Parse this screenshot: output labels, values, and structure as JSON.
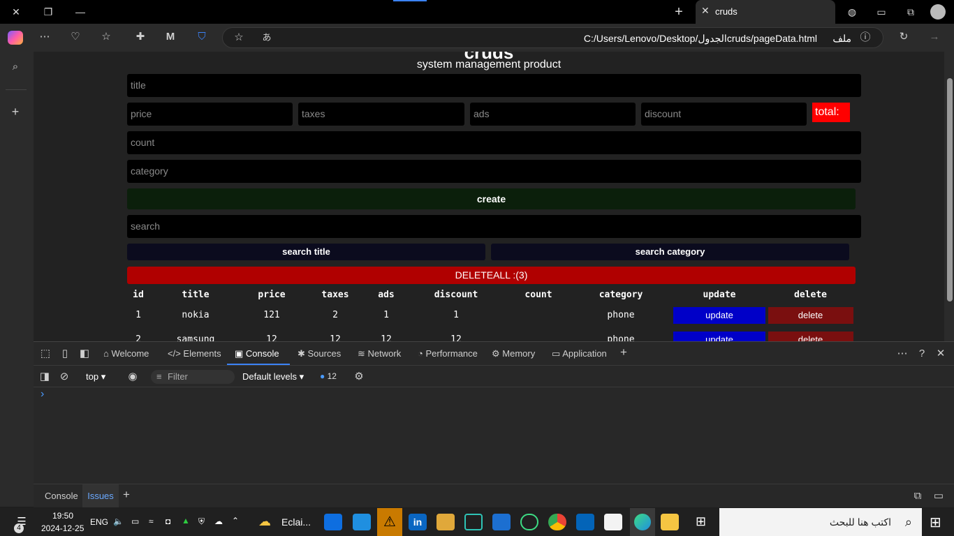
{
  "browser": {
    "tab_title": "cruds",
    "url": "C:/Users/Lenovo/Desktop/الجدولcruds/pageData.html",
    "file_label": "ملف"
  },
  "page": {
    "heading": "cruds",
    "subheading": "system management product",
    "inputs": {
      "title": "title",
      "price": "price",
      "taxes": "taxes",
      "ads": "ads",
      "discount": "discount",
      "count": "count",
      "category": "category",
      "search": "search"
    },
    "total_label": "total:",
    "create_label": "create",
    "search_title_label": "search title",
    "search_category_label": "search category",
    "delete_all_label": "DELETEALL :(3)",
    "table": {
      "headers": [
        "id",
        "title",
        "price",
        "taxes",
        "ads",
        "discount",
        "count",
        "category",
        "update",
        "delete"
      ],
      "rows": [
        {
          "id": "1",
          "title": "nokia",
          "price": "121",
          "taxes": "2",
          "ads": "1",
          "discount": "1",
          "count": "",
          "category": "phone",
          "update": "update",
          "delete": "delete"
        },
        {
          "id": "2",
          "title": "samsung",
          "price": "12",
          "taxes": "12",
          "ads": "12",
          "discount": "12",
          "count": "",
          "category": "phone",
          "update": "update",
          "delete": "delete"
        }
      ]
    }
  },
  "devtools": {
    "tabs": [
      "Welcome",
      "Elements",
      "Console",
      "Sources",
      "Network",
      "Performance",
      "Memory",
      "Application"
    ],
    "context": "top",
    "filter_placeholder": "Filter",
    "levels": "Default levels",
    "issues_count": "12",
    "prompt": "›",
    "drawer_tabs": [
      "Console",
      "Issues"
    ]
  },
  "taskbar": {
    "time": "19:50",
    "date": "2024-12-25",
    "lang": "ENG",
    "search_placeholder": "اكتب هنا للبحث",
    "weather_label": "Eclai...",
    "notif_count": "4"
  }
}
